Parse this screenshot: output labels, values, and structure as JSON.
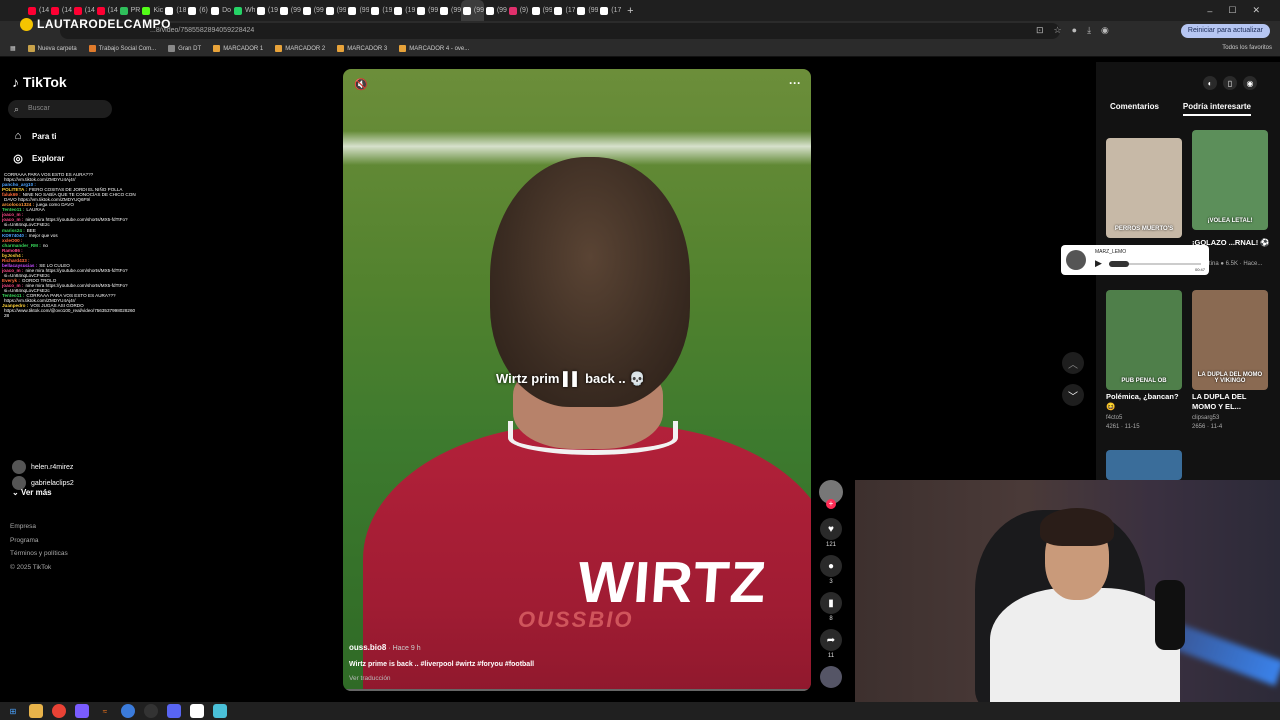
{
  "browser": {
    "tabs": [
      {
        "label": "(14",
        "color": "#ff0033"
      },
      {
        "label": "(14",
        "color": "#ff0033"
      },
      {
        "label": "(14",
        "color": "#ff0033"
      },
      {
        "label": "(14",
        "color": "#ff0033"
      },
      {
        "label": "PR",
        "color": "#2fbf5b"
      },
      {
        "label": "Kic",
        "color": "#53fc18"
      },
      {
        "label": "(18",
        "color": "#ffffff"
      },
      {
        "label": "(6)",
        "color": "#ffffff"
      },
      {
        "label": "Do",
        "color": "#ffffff"
      },
      {
        "label": "Wh",
        "color": "#25d366"
      },
      {
        "label": "(19",
        "color": "#ffffff"
      },
      {
        "label": "(99",
        "color": "#ffffff"
      },
      {
        "label": "(99",
        "color": "#ffffff"
      },
      {
        "label": "(99",
        "color": "#ffffff"
      },
      {
        "label": "(99",
        "color": "#ffffff"
      },
      {
        "label": "(19",
        "color": "#ffffff"
      },
      {
        "label": "(19",
        "color": "#ffffff"
      },
      {
        "label": "(99",
        "color": "#ffffff"
      },
      {
        "label": "(99",
        "color": "#ffffff"
      },
      {
        "label": "(99",
        "color": "#ffffff"
      },
      {
        "label": "(99",
        "color": "#ffffff"
      },
      {
        "label": "(9)",
        "color": "#e1306c"
      },
      {
        "label": "(99",
        "color": "#ffffff"
      },
      {
        "label": "(17",
        "color": "#ffffff"
      },
      {
        "label": "(99",
        "color": "#ffffff"
      },
      {
        "label": "(17",
        "color": "#ffffff"
      }
    ],
    "active_tab_index": 19,
    "new_tab": "+",
    "window_controls": [
      "–",
      "☐",
      "✕"
    ],
    "url": "...8/video/7585582894059228424",
    "stream_logo": "LAUTARODELCAMPO",
    "reinit_button": "Reiniciar para actualizar",
    "bookmarks": [
      {
        "label": "Nueva carpeta",
        "color": "#c8a24a"
      },
      {
        "label": "Trabajo Social Com...",
        "color": "#e07b2c"
      },
      {
        "label": "Gran DT",
        "color": "#888888"
      },
      {
        "label": "MARCADOR 1",
        "color": "#e8a33a"
      },
      {
        "label": "MARCADOR 2",
        "color": "#e8a33a"
      },
      {
        "label": "MARCADOR 3",
        "color": "#e8a33a"
      },
      {
        "label": "MARCADOR 4 - ove...",
        "color": "#e8a33a"
      }
    ],
    "bookmarks_all": "Todos los favoritos"
  },
  "tiktok": {
    "logo": "TikTok",
    "search_placeholder": "Buscar",
    "nav": {
      "for_you": "Para ti",
      "explore": "Explorar"
    },
    "following": [
      {
        "name": "helen.r4mirez"
      },
      {
        "name": "gabrielaclips2"
      }
    ],
    "see_more": "Ver más",
    "footer": [
      "Empresa",
      "Programa",
      "Términos y políticas",
      "© 2025 TikTok"
    ]
  },
  "chat": [
    {
      "user": "",
      "color": "#ffffff",
      "text": "CORRAAA PARA VOS ESTO ES AURA???"
    },
    {
      "user": "",
      "color": "#ffffff",
      "text": "https://vm.tiktok.com/ZMDYU4Aj4r/"
    },
    {
      "user": "pancho_arg10 :",
      "color": "#4aa3ff",
      "text": ""
    },
    {
      "user": "POLITETA :",
      "color": "#ffd23a",
      "text": "FIERO COSITAS DE JORDI EL NIÑO POLLA"
    },
    {
      "user": "faluk69 :",
      "color": "#ff6a3a",
      "text": "NINE NO SABÍA QUE TE CONOCÍAS DE CHICO CON"
    },
    {
      "user": "",
      "color": "#ffffff",
      "text": "DAVO https://vm.tiktok.com/ZMDYUQ6F9/"
    },
    {
      "user": "arcoloco1324 :",
      "color": "#ff9a3a",
      "text": "juega como DAVO"
    },
    {
      "user": "Tenteo11 :",
      "color": "#38d65a",
      "text": "LAURAA"
    },
    {
      "user": "joaco_m :",
      "color": "#ff4a8a",
      "text": ""
    },
    {
      "user": "joaco_m :",
      "color": "#ff4a8a",
      "text": "nine mira https://youtube.com/shorts/MX5-fdTtFo?"
    },
    {
      "user": "",
      "color": "#ffffff",
      "text": "si=Un84nqLovCFsE2c"
    },
    {
      "user": "mariss24 :",
      "color": "#38d65a",
      "text": "BEE"
    },
    {
      "user": "KD974040 :",
      "color": "#4aa3ff",
      "text": "mejor que vos"
    },
    {
      "user": "xxleO00 :",
      "color": "#ff6a3a",
      "text": ""
    },
    {
      "user": "charmander_RM :",
      "color": "#38d65a",
      "text": "no"
    },
    {
      "user": "Ramo86 :",
      "color": "#ff4a8a",
      "text": ""
    },
    {
      "user": "byJosh4 :",
      "color": "#ffd23a",
      "text": ""
    },
    {
      "user": "Richard433 :",
      "color": "#ff6a3a",
      "text": ""
    },
    {
      "user": "bellacaysucias :",
      "color": "#c34aff",
      "text": "SE LO CULEO"
    },
    {
      "user": "joaco_m :",
      "color": "#ff4a8a",
      "text": "nine mira https://youtube.com/shorts/MX5-fdTtFo?"
    },
    {
      "user": "",
      "color": "#ffffff",
      "text": "si=Un84nqLovCFsE2c"
    },
    {
      "user": "Everyk :",
      "color": "#ff6a3a",
      "text": "GORDO TROLO"
    },
    {
      "user": "joaco_m :",
      "color": "#ff4a8a",
      "text": "nine mira https://youtube.com/shorts/MX5-fdTtFo?"
    },
    {
      "user": "",
      "color": "#ffffff",
      "text": "si=Un84nqLovCFsE2c"
    },
    {
      "user": "Tenteo11 :",
      "color": "#38d65a",
      "text": "CORRAAA PARA VOS ESTO ES AURA???"
    },
    {
      "user": "",
      "color": "#ffffff",
      "text": "https://vm.tiktok.com/ZMDYU4Aj4r/"
    },
    {
      "user": "Juanpedro :",
      "color": "#ffd23a",
      "text": "VOS JUGAS ASI GORDO"
    },
    {
      "user": "",
      "color": "#ffffff",
      "text": "https://www.tiktok.com/@ovo100_real/video/7563537998028260"
    },
    {
      "user": "",
      "color": "#ffffff",
      "text": "28"
    }
  ],
  "video": {
    "overlay_caption": "Wirtz prim ▌▌ back .. 💀",
    "jersey_name": "WIRTZ",
    "watermark": "OUSSBIO",
    "author": "ouss.bio8",
    "time_ago": "· Hace 9 h",
    "description": "Wirtz prime is back .. #liverpool #wirtz #foryou #football",
    "translate": "Ver traducción",
    "likes": "121",
    "comments": "3",
    "saves": "8",
    "shares": "11"
  },
  "right_panel": {
    "tabs": {
      "comments": "Comentarios",
      "suggested": "Podría interesarte"
    },
    "cards": [
      {
        "title": "",
        "meta": "",
        "bg": "#c7b9a7",
        "thumb_text": "PERROS MUERTO'S"
      },
      {
        "title": "¡GOLAZO ...RNAL! ⚽ 🔥",
        "meta": "...rgentina ● 6.5K · Hace...",
        "bg": "#5c8f5a",
        "thumb_text": "¡VOLEA LETAL!"
      },
      {
        "title": "Polémica, ¿bancan? 😆",
        "meta": "f4cto5\n4261 · 11-15",
        "bg": "#4f7f4a",
        "thumb_text": "PUB PENAL OB"
      },
      {
        "title": "LA DUPLA DEL MOMO Y EL...",
        "meta": "clipsarg53\n2656 · 11-4",
        "bg": "#8a6a52",
        "thumb_text": "LA DUPLA DEL MOMO Y VIKINGO"
      }
    ],
    "audio_popup": {
      "name": "MARZ_LEMO",
      "time": "00:47"
    }
  }
}
